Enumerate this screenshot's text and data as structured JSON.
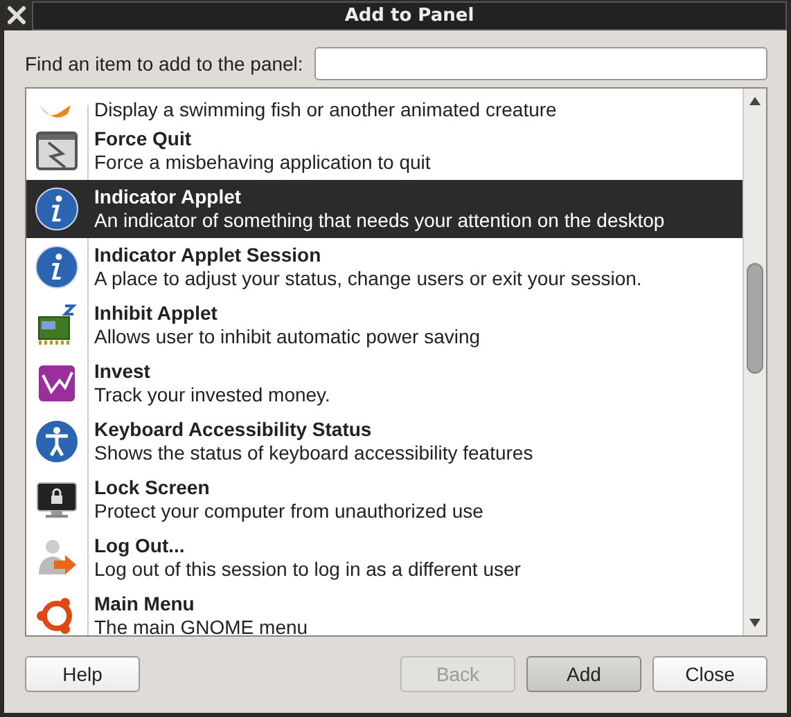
{
  "window": {
    "title": "Add to Panel"
  },
  "search": {
    "label": "Find an item to add to the panel:"
  },
  "items": [
    {
      "kind": "fish",
      "description": "Display a swimming fish or another animated creature",
      "selected": false
    },
    {
      "kind": "window",
      "title": "Force Quit",
      "description": "Force a misbehaving application to quit",
      "selected": false
    },
    {
      "kind": "info",
      "title": "Indicator Applet",
      "description": "An indicator of something that needs your attention on the desktop",
      "selected": true
    },
    {
      "kind": "info",
      "title": "Indicator Applet Session",
      "description": "A place to adjust your status, change users or exit your session.",
      "selected": false
    },
    {
      "kind": "chip",
      "title": "Inhibit Applet",
      "description": "Allows user to inhibit automatic power saving",
      "selected": false
    },
    {
      "kind": "chart",
      "title": "Invest",
      "description": "Track your invested money.",
      "selected": false
    },
    {
      "kind": "accessibility",
      "title": "Keyboard Accessibility Status",
      "description": "Shows the status of keyboard accessibility features",
      "selected": false
    },
    {
      "kind": "monitor",
      "title": "Lock Screen",
      "description": "Protect your computer from unauthorized use",
      "selected": false
    },
    {
      "kind": "person",
      "title": "Log Out...",
      "description": "Log out of this session to log in as a different user",
      "selected": false
    },
    {
      "kind": "ubuntu",
      "title": "Main Menu",
      "description": "The main GNOME menu",
      "selected": false
    }
  ],
  "buttons": [
    {
      "label": "Help",
      "disabled": false,
      "default": false
    },
    {
      "label": "Back",
      "disabled": true,
      "default": false
    },
    {
      "label": "Add",
      "disabled": false,
      "default": true
    },
    {
      "label": "Close",
      "disabled": false,
      "default": false
    }
  ]
}
